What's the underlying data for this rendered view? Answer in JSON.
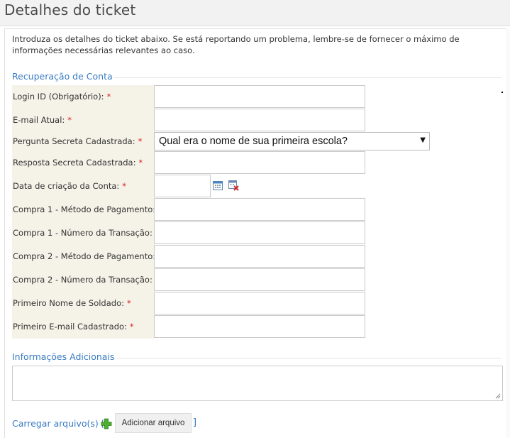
{
  "header": {
    "title": "Detalhes do ticket"
  },
  "intro": "Introduza os detalhes do ticket abaixo. Se está reportando um problema, lembre-se de fornecer o máximo de informações necessárias relevantes ao caso.",
  "sections": {
    "account": "Recuperação de Conta",
    "additional": "Informações Adicionais"
  },
  "fields": {
    "login_id": {
      "label": "Login ID (Obrigatório):",
      "required": "*",
      "value": ""
    },
    "email": {
      "label": "E-mail Atual:",
      "required": "*",
      "value": ""
    },
    "secret_question": {
      "label": "Pergunta Secreta Cadastrada:",
      "required": "*",
      "selected": "Qual era o nome de sua primeira escola?"
    },
    "secret_answer": {
      "label": "Resposta Secreta Cadastrada:",
      "required": "*",
      "value": ""
    },
    "created_date": {
      "label": "Data de criação da Conta:",
      "required": "*",
      "value": ""
    },
    "purchase1_method": {
      "label": "Compra 1 - Método de Pagamento:",
      "value": ""
    },
    "purchase1_txn": {
      "label": "Compra 1 - Número da Transação:",
      "value": ""
    },
    "purchase2_method": {
      "label": "Compra 2 - Método de Pagamento:",
      "value": ""
    },
    "purchase2_txn": {
      "label": "Compra 2 - Número da Transação:",
      "value": ""
    },
    "soldier_name": {
      "label": "Primeiro Nome de Soldado:",
      "required": "*",
      "value": ""
    },
    "first_email": {
      "label": "Primeiro E-mail Cadastrado:",
      "required": "*",
      "value": ""
    }
  },
  "upload": {
    "label": "Carregar arquivo(s) [",
    "button": "Adicionar arquivo",
    "close": "]"
  },
  "icons": {
    "calendar": "calendar-icon",
    "clear_date": "clear-date-icon",
    "add": "plus-icon",
    "dropdown": "chevron-down-icon"
  },
  "colors": {
    "accent": "#3a7cc2",
    "required": "#d61f1f",
    "label_bg": "#f5f3e8"
  }
}
